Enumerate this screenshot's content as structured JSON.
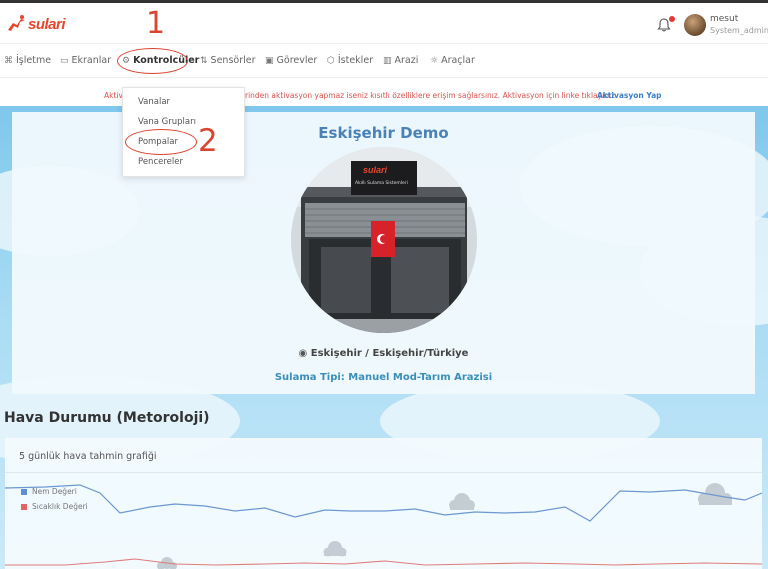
{
  "header": {
    "logo_text": "sulari",
    "user_name": "mesut",
    "user_role": "System_admin"
  },
  "nav": {
    "items": [
      {
        "label": "İşletme",
        "icon": "command-icon"
      },
      {
        "label": "Ekranlar",
        "icon": "monitor-icon"
      },
      {
        "label": "Kontrolcüler",
        "icon": "gear-icon"
      },
      {
        "label": "Sensörler",
        "icon": "sensor-icon"
      },
      {
        "label": "Görevler",
        "icon": "briefcase-icon"
      },
      {
        "label": "İstekler",
        "icon": "cube-icon"
      },
      {
        "label": "Arazi",
        "icon": "map-icon"
      },
      {
        "label": "Araçlar",
        "icon": "sun-icon"
      }
    ]
  },
  "notice": {
    "text_left": "Aktiv",
    "text_right": "rinden aktivasyon yapmaz iseniz kısıtlı özelliklere erişim sağlarsınız. Aktivasyon için linke tıklayınız",
    "link": "Aktivasyon Yap"
  },
  "dropdown": {
    "items": [
      "Vanalar",
      "Vana Grupları",
      "Pompalar",
      "Pencereler"
    ]
  },
  "farm": {
    "title": "Eskişehir Demo",
    "location": "Eskişehir / Eskişehir/Türkiye",
    "sulama": "Sulama Tipi: Manuel Mod-Tarım Arazisi",
    "sign_brand": "sulari",
    "sign_text": "Akıllı Sulama Sistemleri"
  },
  "weather": {
    "heading": "Hava Durumu (Metoroloji)",
    "subtitle": "5 günlük hava tahmin grafiği"
  },
  "chart_data": {
    "type": "line",
    "title": "5 günlük hava tahmin grafiği",
    "series": [
      {
        "name": "Nem Değeri",
        "color": "#5b8fd6"
      },
      {
        "name": "Sıcaklık Değeri",
        "color": "#e06666"
      }
    ]
  },
  "annotations": {
    "step1": "1",
    "step2": "2"
  },
  "colors": {
    "brand": "#e8452c",
    "accent": "#4a82b8",
    "annotation": "#d9452f"
  }
}
